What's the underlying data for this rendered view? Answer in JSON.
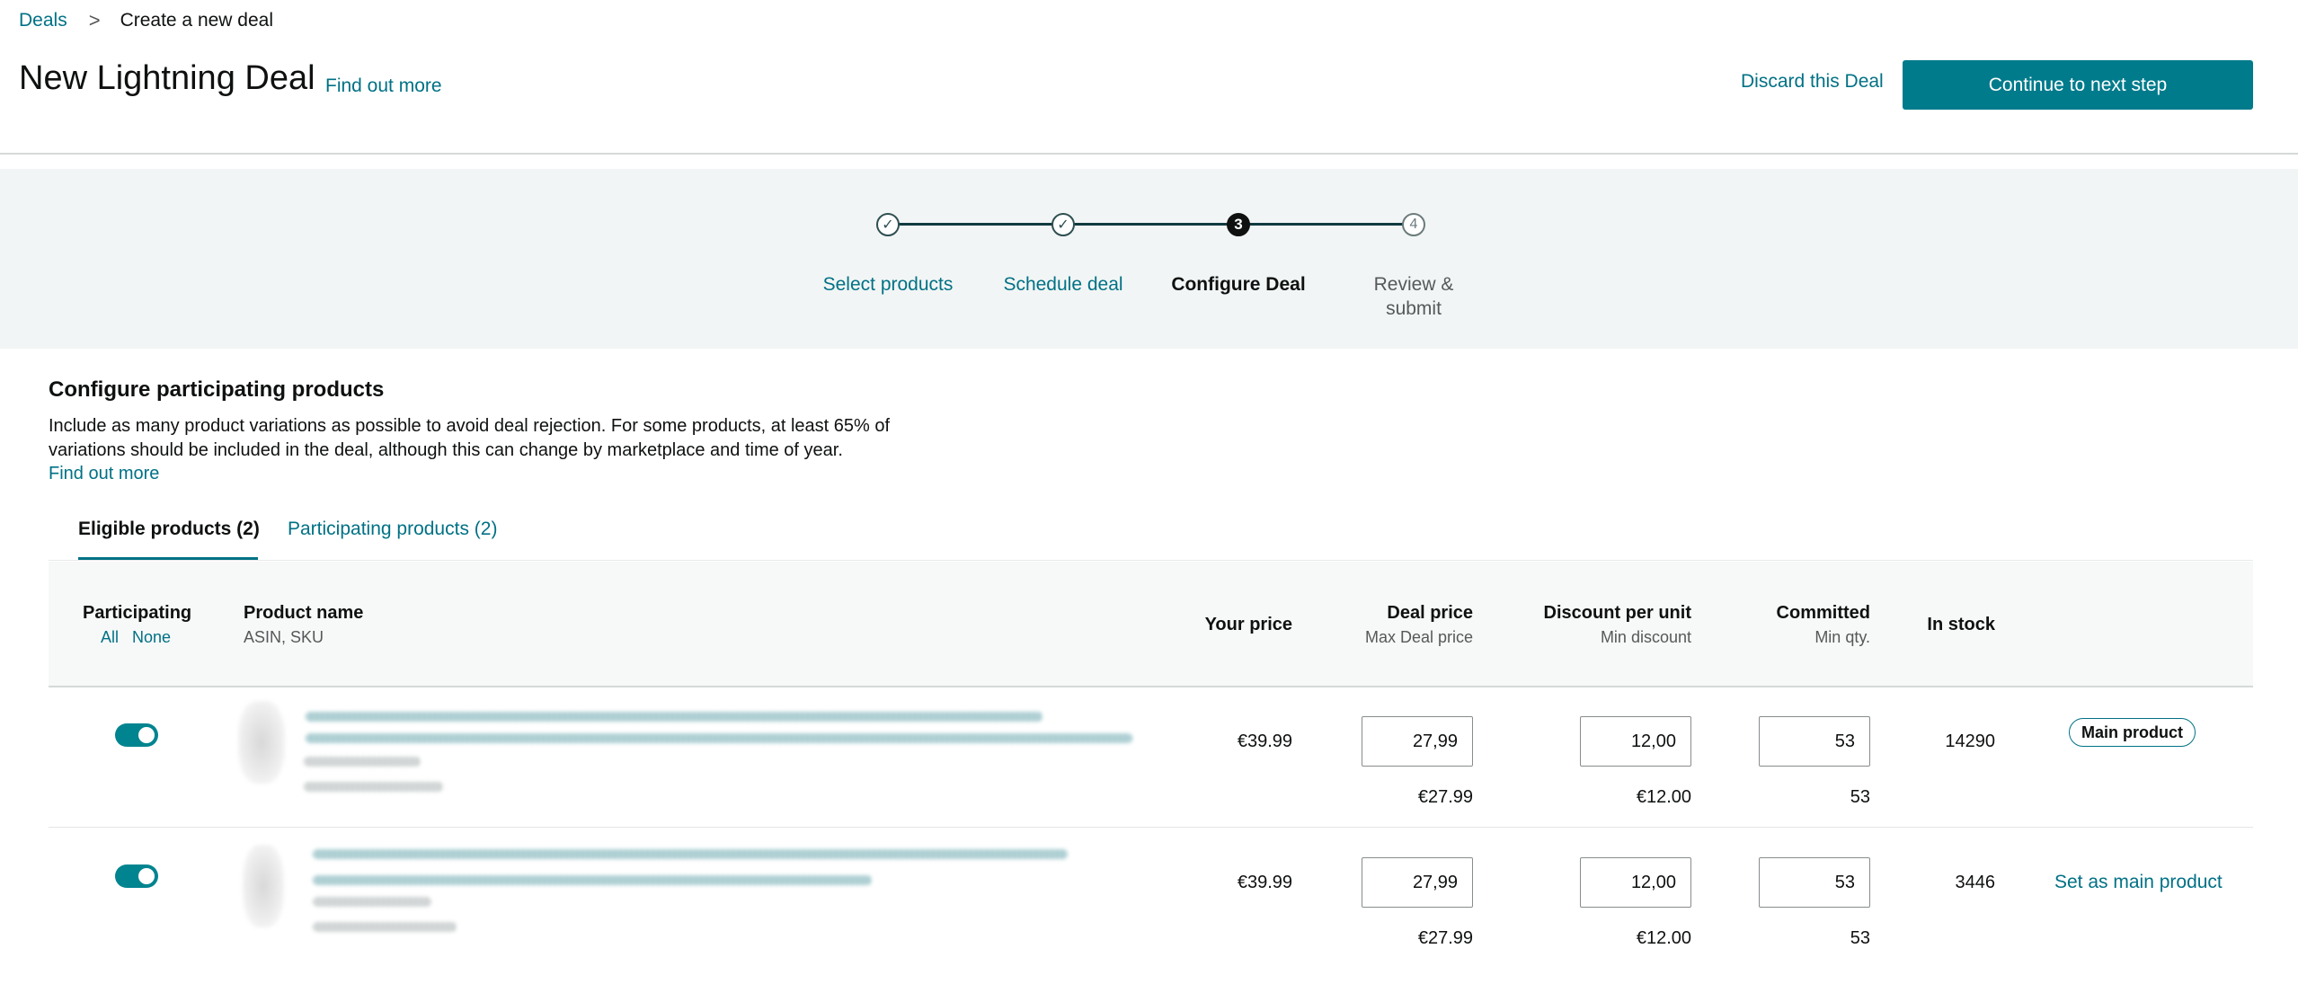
{
  "breadcrumb": {
    "root": "Deals",
    "separator": ">",
    "current": "Create a new deal"
  },
  "header": {
    "title": "New Lightning Deal",
    "find_out_more": "Find out more",
    "discard": "Discard this Deal",
    "continue": "Continue to next step"
  },
  "stepper": {
    "steps": [
      {
        "label": "Select products",
        "marker": "✓",
        "state": "done"
      },
      {
        "label": "Schedule deal",
        "marker": "✓",
        "state": "done"
      },
      {
        "label": "Configure Deal",
        "marker": "3",
        "state": "current"
      },
      {
        "label": "Review & submit",
        "marker": "4",
        "state": "upcoming"
      }
    ]
  },
  "section": {
    "title": "Configure participating products",
    "description": "Include as many product variations as possible to avoid deal rejection. For some products, at least 65% of variations should be included in the deal, although this can change by marketplace and time of year.",
    "find_out_more": "Find out more"
  },
  "tabs": [
    {
      "label": "Eligible products (2)",
      "active": true
    },
    {
      "label": "Participating products (2)",
      "active": false
    }
  ],
  "table": {
    "columns": {
      "participating": "Participating",
      "select_all": "All",
      "select_none": "None",
      "product_name": "Product name",
      "product_sub": "ASIN, SKU",
      "your_price": "Your price",
      "deal_price": "Deal price",
      "deal_price_sub": "Max Deal price",
      "discount": "Discount per unit",
      "discount_sub": "Min discount",
      "committed": "Committed",
      "committed_sub": "Min qty.",
      "in_stock": "In stock"
    },
    "rows": [
      {
        "participating": true,
        "your_price": "€39.99",
        "deal_price": "27,99",
        "max_deal_price": "€27.99",
        "discount": "12,00",
        "min_discount": "€12.00",
        "committed": "53",
        "min_qty": "53",
        "in_stock": "14290",
        "action": "Main product"
      },
      {
        "participating": true,
        "your_price": "€39.99",
        "deal_price": "27,99",
        "max_deal_price": "€27.99",
        "discount": "12,00",
        "min_discount": "€12.00",
        "committed": "53",
        "min_qty": "53",
        "in_stock": "3446",
        "action": "Set as main product"
      }
    ]
  },
  "colors": {
    "accent": "#007185",
    "primary_button": "#007b8c",
    "toggle_on": "#00848f",
    "band": "#f2f5f5"
  }
}
